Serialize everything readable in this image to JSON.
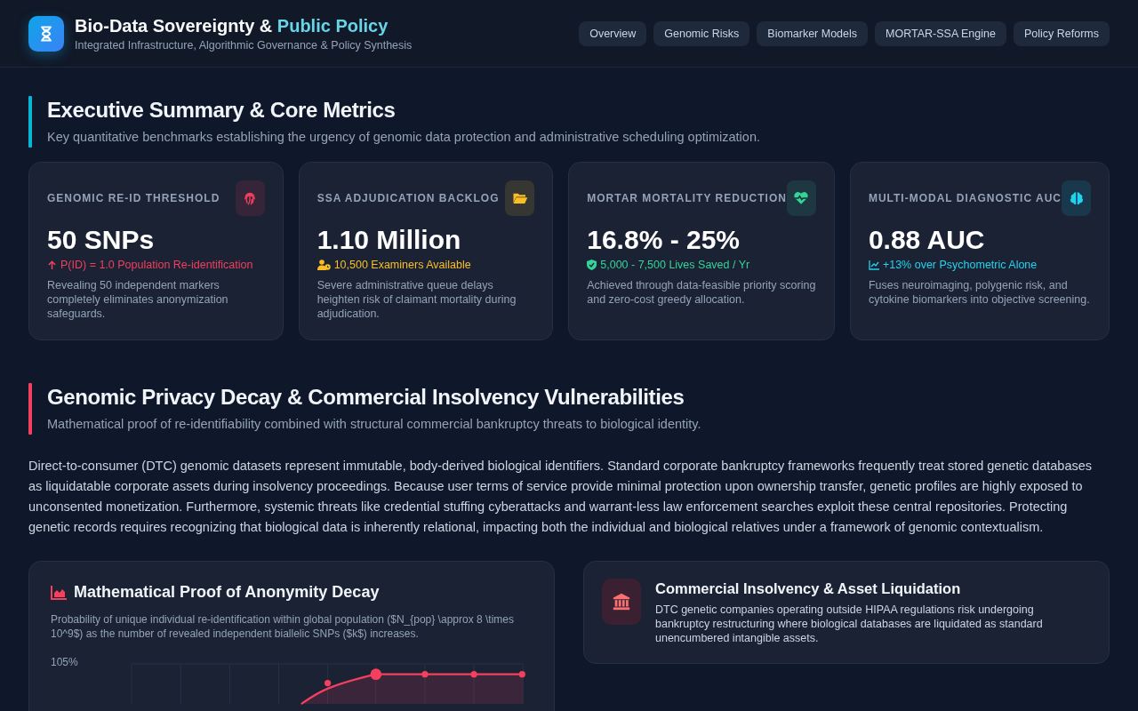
{
  "header": {
    "title": "Bio-Data Sovereignty &",
    "title_highlight": "Public Policy",
    "subtitle": "Integrated Infrastructure, Algorithmic Governance & Policy Synthesis"
  },
  "nav": [
    {
      "label": "Overview",
      "selected": false
    },
    {
      "label": "Genomic Risks",
      "selected": false
    },
    {
      "label": "Biomarker Models",
      "selected": false
    },
    {
      "label": "MORTAR-SSA Engine",
      "selected": false
    },
    {
      "label": "Policy Reforms",
      "selected": false
    }
  ],
  "summary": {
    "title": "Executive Summary & Core Metrics",
    "description": "Key quantitative benchmarks establishing the urgency of genomic data protection and administrative scheduling optimization.",
    "color": "#06b6d4",
    "metrics": [
      {
        "label": "GENOMIC RE-ID THRESHOLD",
        "color": "#f43f5e",
        "value": "50 SNPs",
        "sub": "P(ID) = 1.0 Population Re-identification",
        "description": "Revealing 50 independent markers completely eliminates anonymization safeguards."
      },
      {
        "label": "SSA ADJUDICATION BACKLOG",
        "color": "#fbbf24",
        "value": "1.10 Million",
        "sub": "10,500 Examiners Available",
        "description": "Severe administrative queue delays heighten risk of claimant mortality during adjudication."
      },
      {
        "label": "MORTAR MORTALITY REDUCTION",
        "color": "#34d399",
        "value": "16.8% - 25%",
        "sub": "5,000 - 7,500 Lives Saved / Yr",
        "description": "Achieved through data-feasible priority scoring and zero-cost greedy allocation."
      },
      {
        "label": "MULTI-MODAL DIAGNOSTIC AUC",
        "color": "#22d3ee",
        "value": "0.88 AUC",
        "sub": "+13% over Psychometric Alone",
        "description": "Fuses neuroimaging, polygenic risk, and cytokine biomarkers into objective screening."
      }
    ]
  },
  "genomic": {
    "title": "Genomic Privacy Decay & Commercial Insolvency Vulnerabilities",
    "description": "Mathematical proof of re-identifiability combined with structural commercial bankruptcy threats to biological identity.",
    "color": "#f43f5e",
    "body": "Direct-to-consumer (DTC) genomic datasets represent immutable, body-derived biological identifiers. Standard corporate bankruptcy frameworks frequently treat stored genetic databases as liquidatable corporate assets during insolvency proceedings. Because user terms of service provide minimal protection upon ownership transfer, genetic profiles are highly exposed to unconsented monetization. Furthermore, systemic threats like credential stuffing cyberattacks and warrant-less law enforcement searches exploit these central repositories. Protecting genetic records requires recognizing that biological data is inherently relational, impacting both the individual and biological relatives under a framework of genomic contextualism.",
    "chart_card": {
      "title": "Mathematical Proof of Anonymity Decay",
      "description": "Probability of unique individual re-identification within global population ($N_{pop} \\approx 8 \\times 10^9$) as the number of revealed independent biallelic SNPs ($k$) increases.",
      "y_tick": "105%"
    },
    "info_card": {
      "title": "Commercial Insolvency & Asset Liquidation",
      "description": "DTC genetic companies operating outside HIPAA regulations risk undergoing bankruptcy restructuring where biological databases are liquidated as standard unencumbered intangible assets."
    }
  }
}
